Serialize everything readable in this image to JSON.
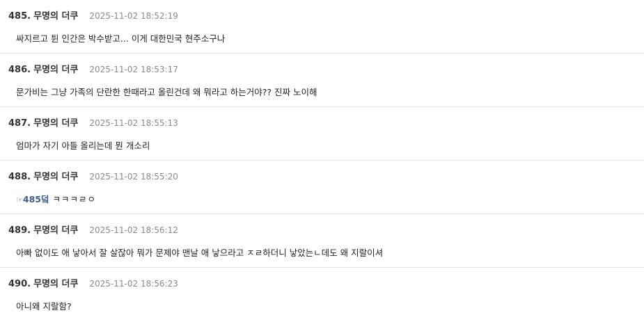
{
  "posts": [
    {
      "number": "485.",
      "author": "무명의 더쿠",
      "timestamp": "2025-11-02 18:52:19",
      "body": "싸지르고 튄 인간은 박수받고... 이게 대한민국 현주소구나"
    },
    {
      "number": "486.",
      "author": "무명의 더쿠",
      "timestamp": "2025-11-02 18:53:17",
      "body": "문가비는 그냥 가족의 단란한 한때라고 올린건데 왜 뭐라고 하는거야?? 진짜 노이해"
    },
    {
      "number": "487.",
      "author": "무명의 더쿠",
      "timestamp": "2025-11-02 18:55:13",
      "body": "엄마가 자기 아들 올리는데 뭔 개소리"
    },
    {
      "number": "488.",
      "author": "무명의 더쿠",
      "timestamp": "2025-11-02 18:55:20",
      "anchor_pointer": "☞",
      "anchor_label": "485덬",
      "body_rest": "ㅋㅋㅋㄹㅇ"
    },
    {
      "number": "489.",
      "author": "무명의 더쿠",
      "timestamp": "2025-11-02 18:56:12",
      "body": "아빠 없이도 애 낳아서 잘 살잖아 뭐가 문제야 맨날 애 낳으라고 ㅈㄹ하더니 낳았는ㄴ데도 왜 지랄이셔"
    },
    {
      "number": "490.",
      "author": "무명의 더쿠",
      "timestamp": "2025-11-02 18:56:23",
      "body": "아니왜 지랄함?"
    }
  ]
}
